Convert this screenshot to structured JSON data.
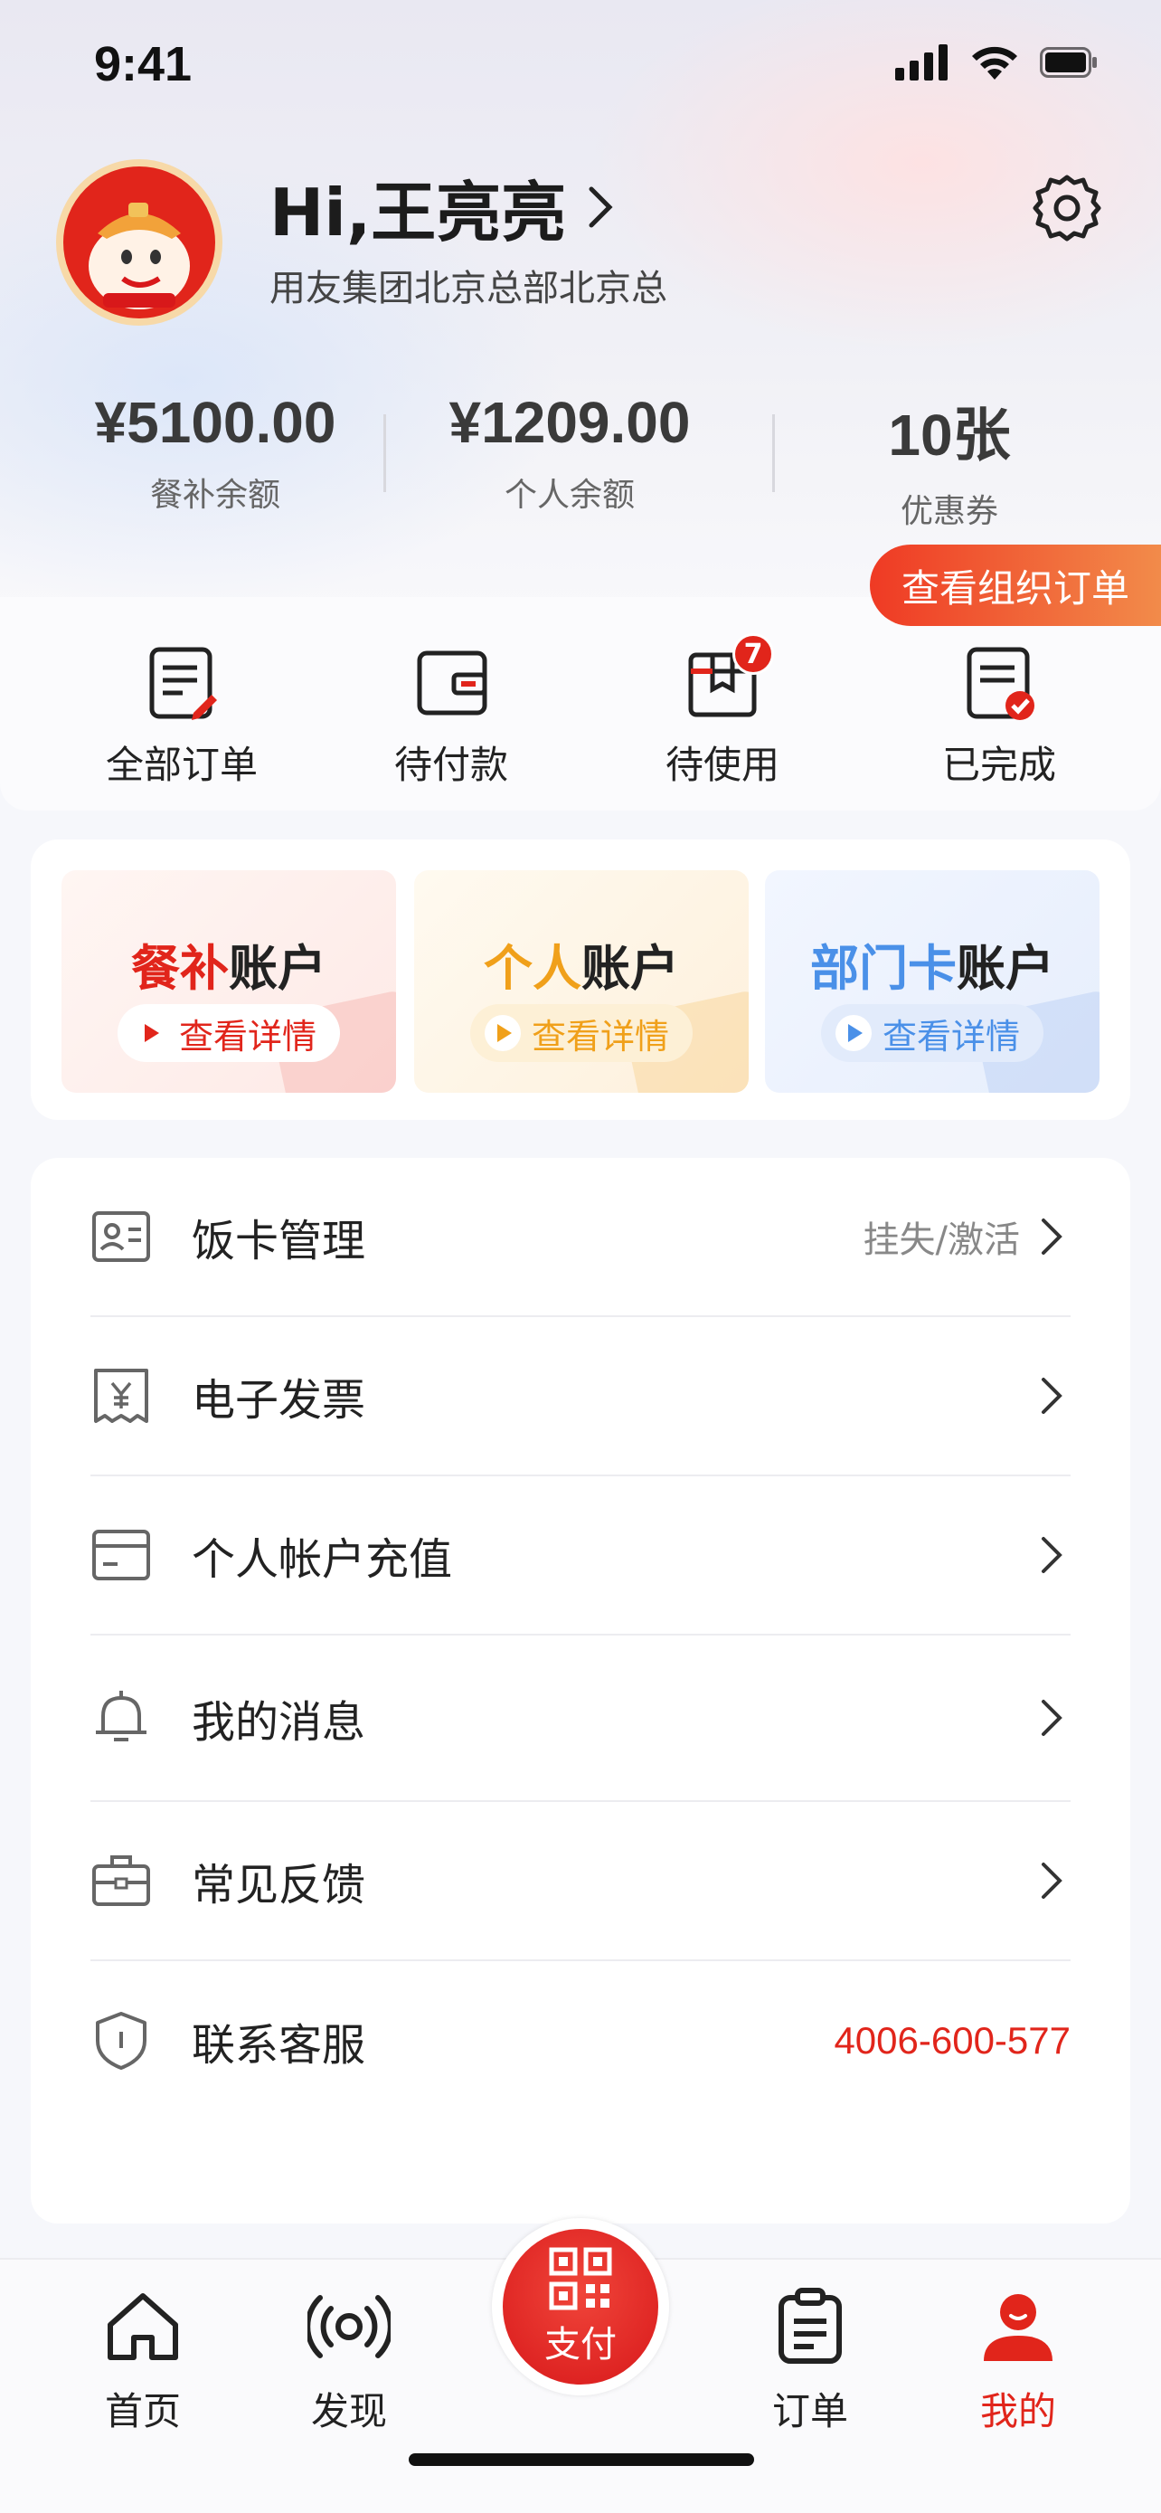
{
  "status_bar": {
    "time": "9:41"
  },
  "profile": {
    "greeting": "Hi,王亮亮",
    "organization": "用友集团北京总部北京总"
  },
  "stats": [
    {
      "value": "¥5100.00",
      "label": "餐补余额"
    },
    {
      "value": "¥1209.00",
      "label": "个人余额"
    },
    {
      "value": "10张",
      "label": "优惠券"
    }
  ],
  "org_order_button": "查看组织订单",
  "orders": [
    {
      "label": "全部订单",
      "icon": "doc-edit-icon"
    },
    {
      "label": "待付款",
      "icon": "wallet-icon"
    },
    {
      "label": "待使用",
      "icon": "box-icon",
      "badge": "7"
    },
    {
      "label": "已完成",
      "icon": "doc-check-icon"
    }
  ],
  "accounts": [
    {
      "highlight": "餐补",
      "suffix": "账户",
      "detail": "查看详情",
      "color": "#e1251b"
    },
    {
      "highlight": "个人",
      "suffix": "账户",
      "detail": "查看详情",
      "color": "#f0a01a"
    },
    {
      "highlight": "部门卡",
      "suffix": "账户",
      "detail": "查看详情",
      "color": "#4a90e8"
    }
  ],
  "menu": [
    {
      "label": "饭卡管理",
      "right": "挂失/激活",
      "icon": "id-card-icon"
    },
    {
      "label": "电子发票",
      "icon": "invoice-icon"
    },
    {
      "label": "个人帐户充值",
      "icon": "card-icon"
    },
    {
      "label": "我的消息",
      "icon": "bell-icon"
    },
    {
      "label": "常见反馈",
      "icon": "briefcase-icon"
    },
    {
      "label": "联系客服",
      "phone": "4006-600-577",
      "icon": "shield-icon"
    }
  ],
  "tabbar": [
    {
      "label": "首页",
      "icon": "home-icon"
    },
    {
      "label": "发现",
      "icon": "broadcast-icon"
    },
    {
      "label": "支付",
      "icon": "qr-code-icon"
    },
    {
      "label": "订单",
      "icon": "clipboard-icon"
    },
    {
      "label": "我的",
      "icon": "user-icon",
      "active": true
    }
  ],
  "colors": {
    "brand_red": "#e1251b",
    "orange": "#f0a01a",
    "blue": "#4a90e8"
  }
}
